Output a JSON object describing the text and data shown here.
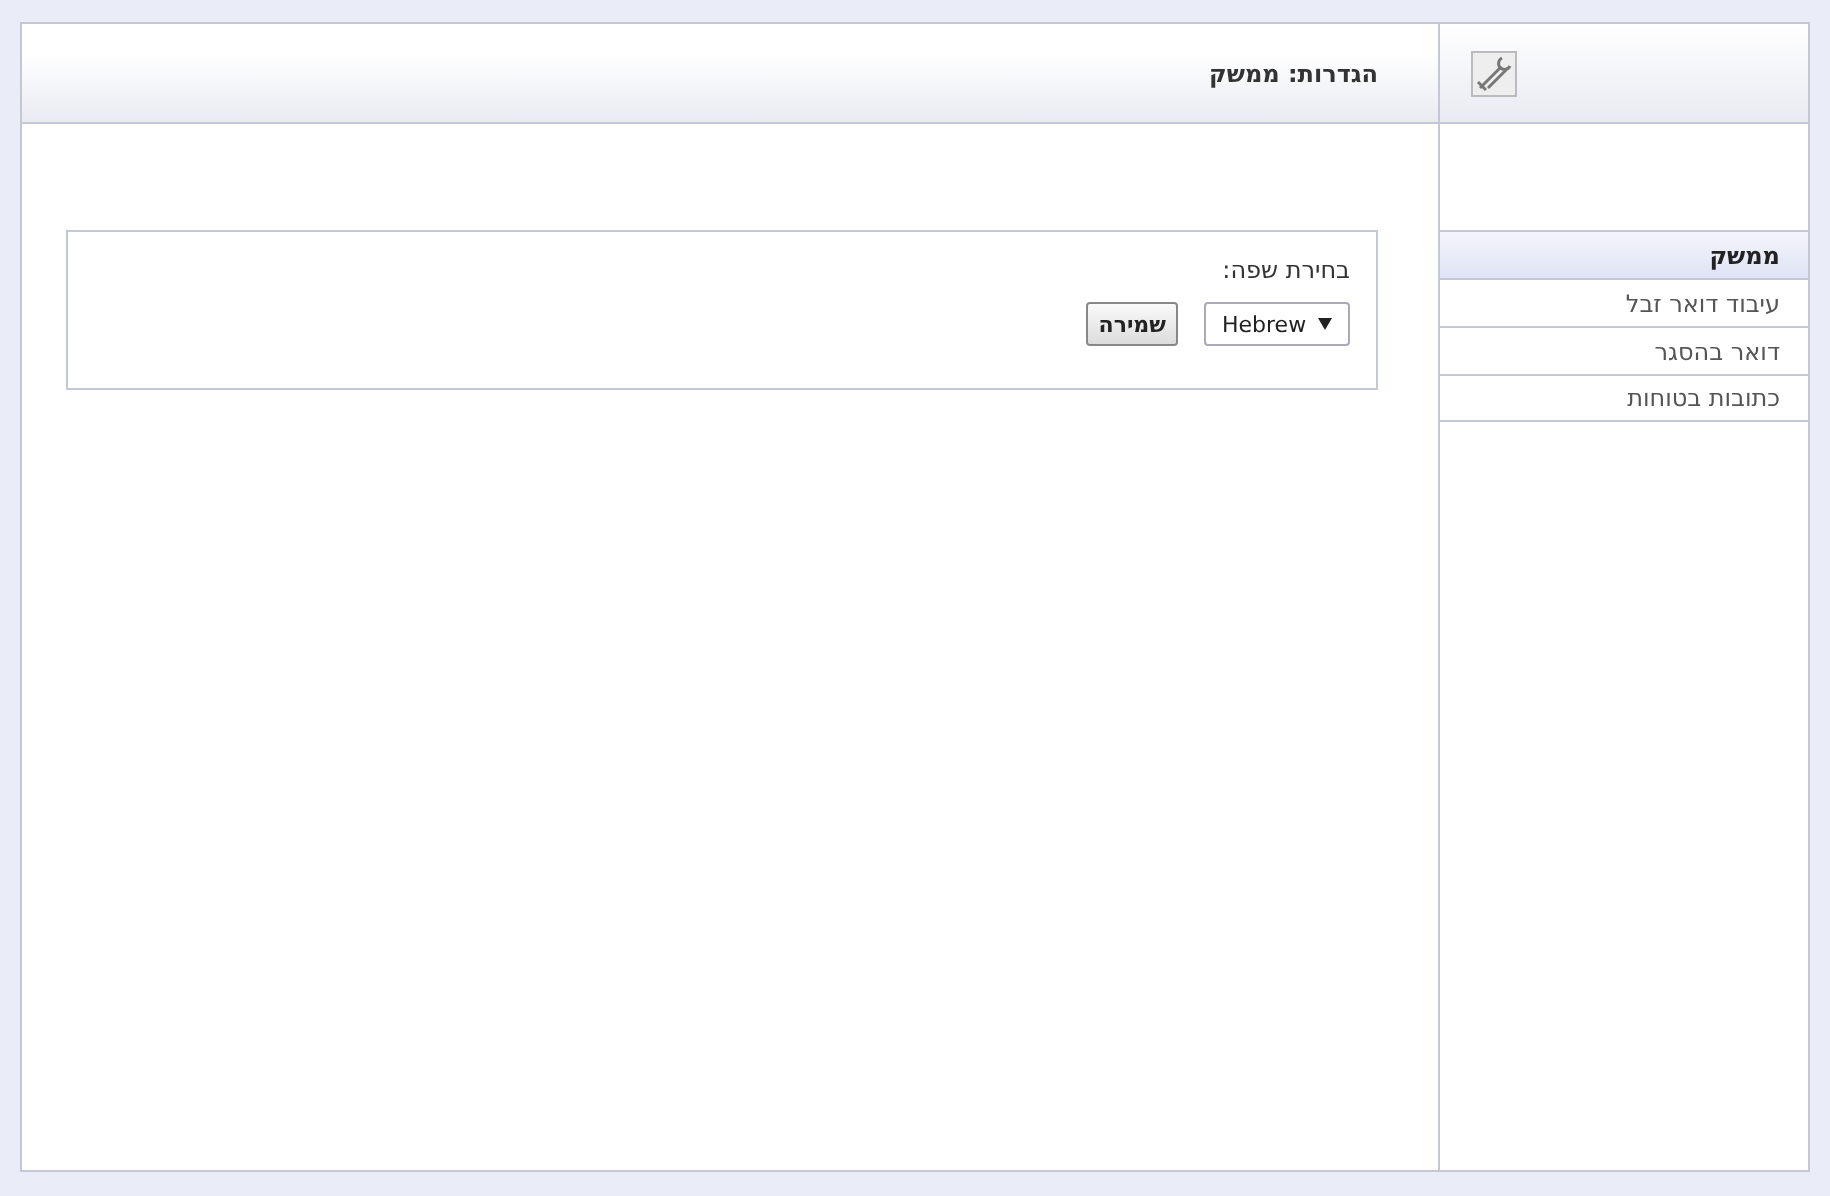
{
  "header": {
    "title": "הגדרות: ממשק"
  },
  "sidebar": {
    "items": [
      {
        "label": "ממשק",
        "selected": true
      },
      {
        "label": "עיבוד דואר זבל",
        "selected": false
      },
      {
        "label": "דואר בהסגר",
        "selected": false
      },
      {
        "label": "כתובות בטוחות",
        "selected": false
      }
    ]
  },
  "panel": {
    "label": "בחירת שפה:",
    "language": "Hebrew",
    "save_button": "שמירה"
  }
}
